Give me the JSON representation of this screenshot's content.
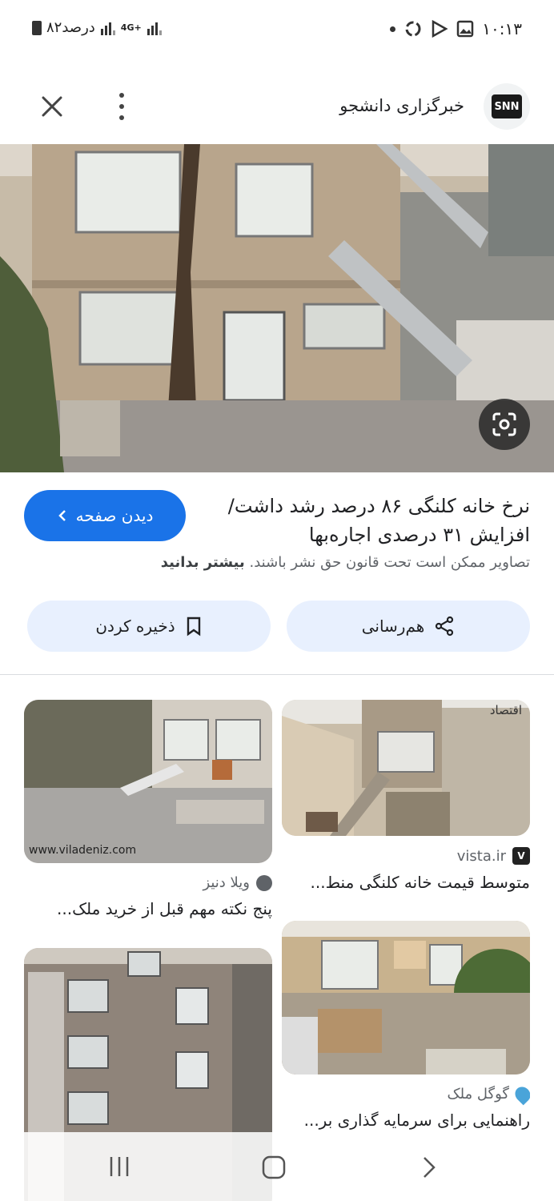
{
  "status": {
    "time": "۱۰:۱۳",
    "battery": "۸۲درصد",
    "network": "4G+"
  },
  "header": {
    "source_logo": "SNN",
    "source_name": "خبرگزاری دانشجو"
  },
  "detail": {
    "title": "نرخ خانه کلنگی ۸۶ درصد رشد داشت/ افزایش ۳۱ درصدی اجاره‌بها",
    "visit_label": "دیدن صفحه",
    "copyright_text": "تصاویر ممکن است تحت قانون حق نشر باشند.",
    "learn_more": "بیشتر بدانید",
    "share_label": "هم‌رسانی",
    "save_label": "ذخیره کردن"
  },
  "results": [
    {
      "source": "vista.ir",
      "caption": "متوسط قیمت خانه کلنگی منط...",
      "overlay": "اقتصاد"
    },
    {
      "source": "ویلا دنیز",
      "caption": "پنج نکته مهم قبل از خرید ملک...",
      "overlay": "www.viladeniz.com"
    },
    {
      "source": "گوگل ملک",
      "caption": "راهنمایی برای سرمایه گذاری بر..."
    }
  ],
  "colors": {
    "accent": "#1a73e8",
    "action_bg": "#e8f0fe"
  }
}
